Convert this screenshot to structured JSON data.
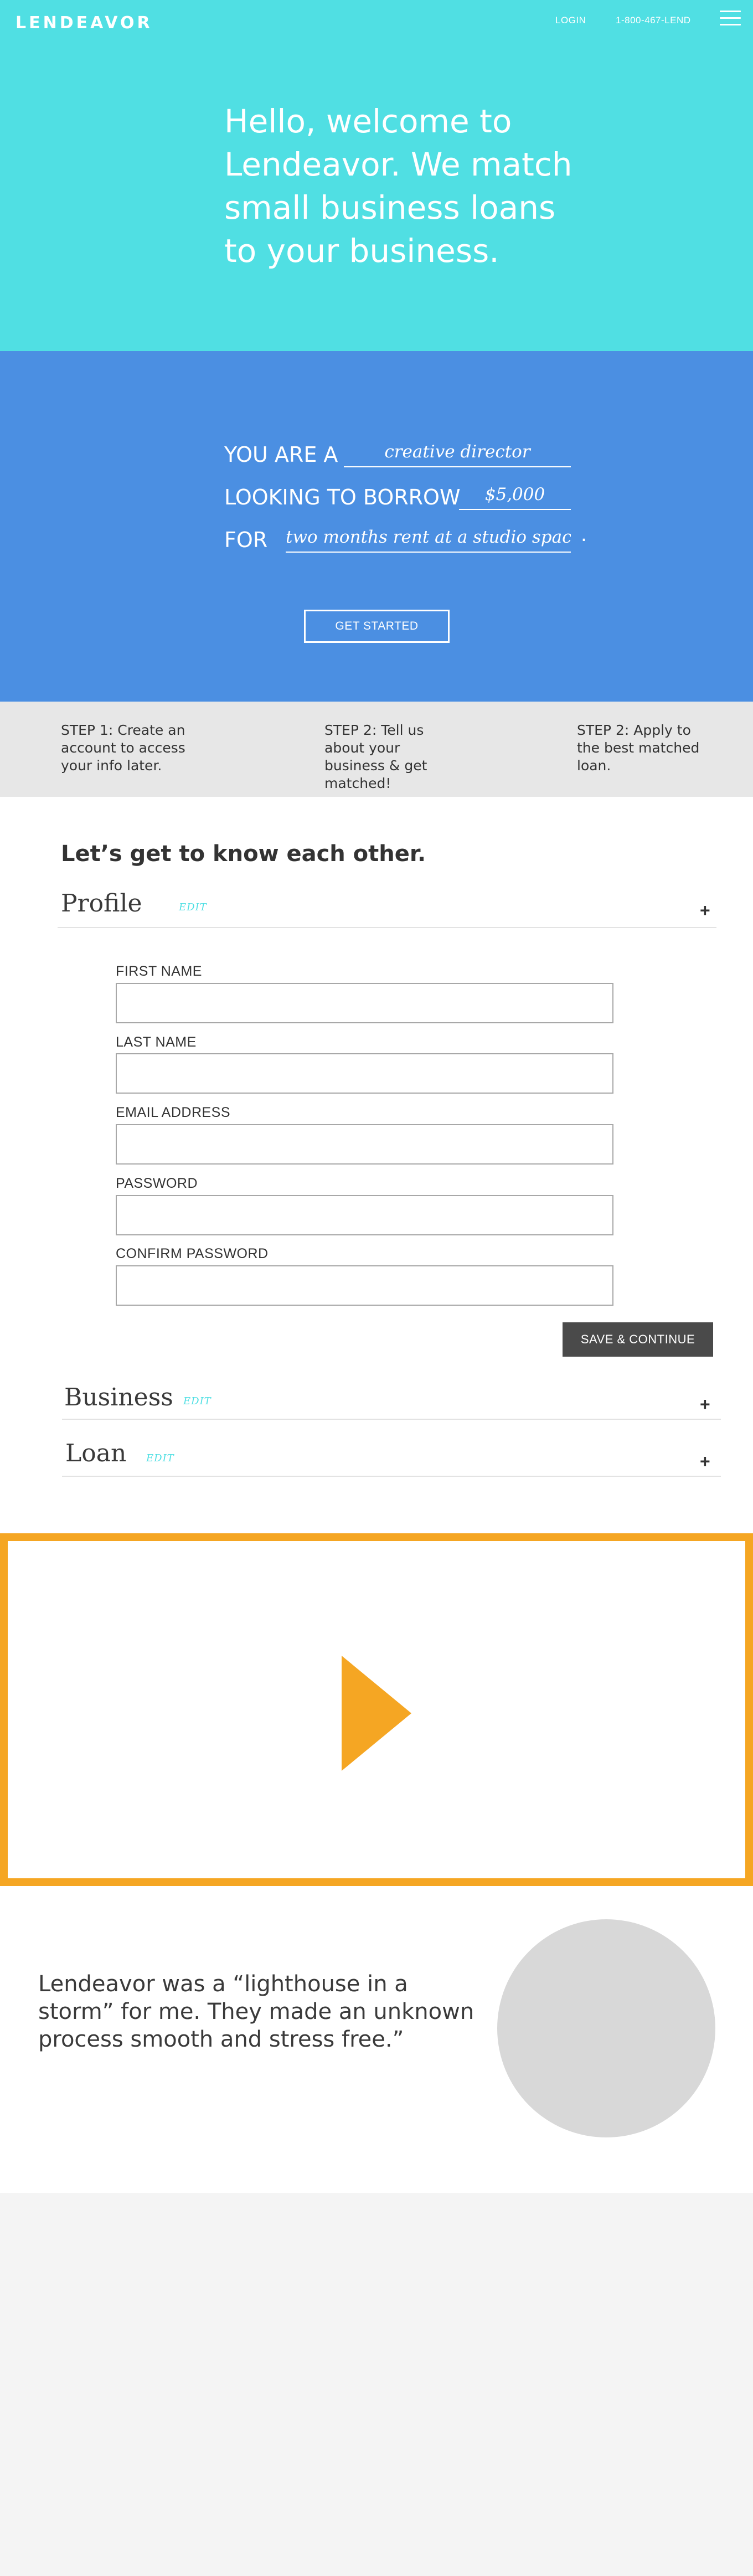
{
  "header": {
    "logo": "LENDEAVOR",
    "nav": {
      "login": "LOGIN",
      "phone": "1-800-467-LEND"
    }
  },
  "hero": {
    "title": "Hello, welcome to Lendeavor. We match small business loans to your business."
  },
  "quick_form": {
    "you_are_label": "YOU ARE A",
    "you_are_value": "creative director",
    "borrow_label": "LOOKING TO BORROW",
    "borrow_value": "$5,000",
    "for_label": "FOR",
    "for_value": "two months rent at a studio space",
    "period": ".",
    "cta": "GET STARTED"
  },
  "steps": [
    {
      "text": "STEP 1: Create an account to access your info later."
    },
    {
      "text": "STEP 2: Tell us about your business & get matched!"
    },
    {
      "text": "STEP 2: Apply to the best matched loan."
    }
  ],
  "signup": {
    "intro": "Let’s get to know each other.",
    "sections": [
      {
        "title": "Profile",
        "edit": "EDIT",
        "toggle": "+"
      },
      {
        "title": "Business",
        "edit": "EDIT",
        "toggle": "+"
      },
      {
        "title": "Loan",
        "edit": "EDIT",
        "toggle": "+"
      }
    ],
    "fields": [
      {
        "label": "FIRST NAME",
        "value": ""
      },
      {
        "label": "LAST NAME",
        "value": ""
      },
      {
        "label": "EMAIL ADDRESS",
        "value": ""
      },
      {
        "label": "PASSWORD",
        "value": ""
      },
      {
        "label": "CONFIRM PASSWORD",
        "value": ""
      }
    ],
    "save": "SAVE & CONTINUE"
  },
  "video": {
    "icon": "play-icon",
    "accent": "#f5a623"
  },
  "testimonial": {
    "quote": "Lendeavor was a “lighthouse in a storm” for me. They made an unknown process smooth and stress free.”"
  },
  "colors": {
    "hero": "#50dfe3",
    "band": "#4b8fe2",
    "steps": "#e7e7e7",
    "button": "#4a4a4a"
  }
}
